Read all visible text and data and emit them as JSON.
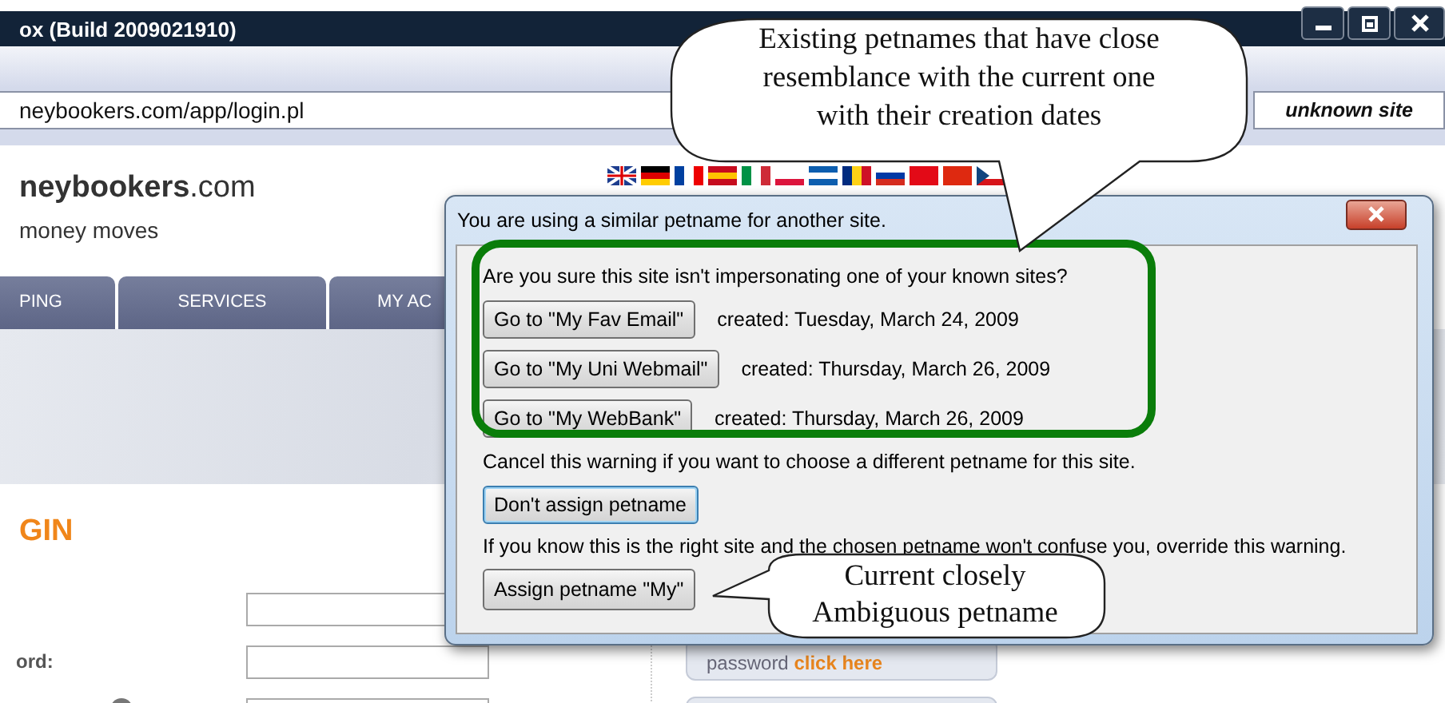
{
  "browser": {
    "title": "ox (Build 2009021910)",
    "address": "neybookers.com/app/login.pl",
    "site_badge": "unknown site"
  },
  "page": {
    "logo": "**neybookers**.com",
    "tagline": "money moves",
    "nav": [
      {
        "label": "PING"
      },
      {
        "label": "SERVICES"
      },
      {
        "label": "MY AC"
      }
    ],
    "heading": "GIN",
    "fields": [
      {
        "kind": "plain"
      },
      {
        "kind": "labeled",
        "label": "ord:"
      },
      {
        "kind": "help"
      }
    ],
    "side_links": [
      {
        "text": "password **click here**"
      }
    ]
  },
  "dialog": {
    "title": "You are using a similar petname for another site.",
    "question": "Are you sure this site isn't impersonating one of your known sites?",
    "matches": [
      {
        "button": "Go to \"My Fav Email\"",
        "created": "created: Tuesday, March 24, 2009"
      },
      {
        "button": "Go to \"My Uni Webmail\"",
        "created": "created: Thursday, March 26, 2009"
      },
      {
        "button": "Go to \"My WebBank\"",
        "created": "created: Thursday, March 26, 2009"
      }
    ],
    "cancel_text": "Cancel this warning if you want to choose a different petname for this site.",
    "cancel_button": {
      "label": "Don't assign petname",
      "focused": true
    },
    "override_text": "If you know this is the right site and the chosen petname won't confuse you, override this warning.",
    "assign_button": {
      "label": "Assign petname \"My\"",
      "focused": false
    }
  },
  "annotations": [
    {
      "kind": "top",
      "text": "Existing petnames that have close resemblance with the current one with their creation dates"
    },
    {
      "kind": "bottom",
      "text": "Current closely Ambiguous petname"
    }
  ]
}
